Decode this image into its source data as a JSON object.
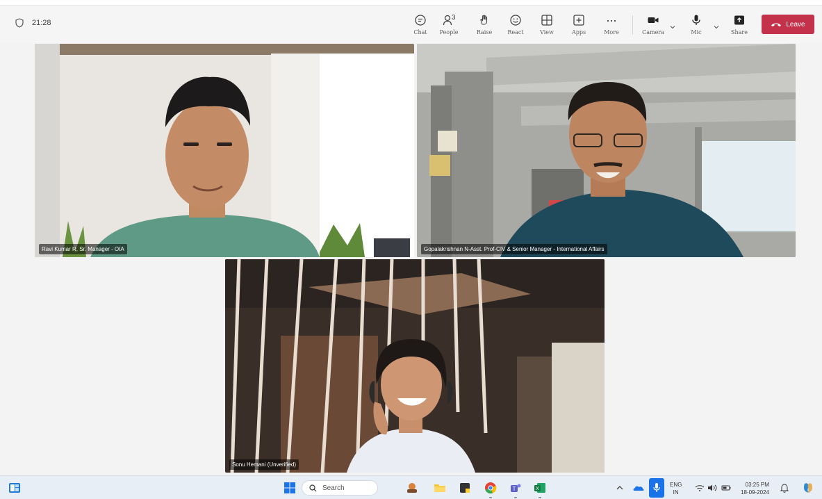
{
  "meeting": {
    "timer": "21:28",
    "people_count": "3",
    "toolbar": {
      "chat": "Chat",
      "people": "People",
      "raise": "Raise",
      "react": "React",
      "view": "View",
      "apps": "Apps",
      "more": "More",
      "camera": "Camera",
      "mic": "Mic",
      "share": "Share",
      "leave": "Leave"
    },
    "colors": {
      "leave_button": "#c4314b",
      "active_speaker_border": "#7f85f5"
    }
  },
  "participants": [
    {
      "name": "Ravi Kumar R, Sr. Manager - OIA"
    },
    {
      "name": "Gopalakrishnan N-Asst. Prof-CIV & Senior Manager - International Affairs"
    },
    {
      "name": "Sonu Hemani (Unverified)"
    }
  ],
  "taskbar": {
    "search_placeholder": "Search",
    "language": "ENG",
    "region": "IN",
    "time": "03:25 PM",
    "date": "18-09-2024"
  }
}
